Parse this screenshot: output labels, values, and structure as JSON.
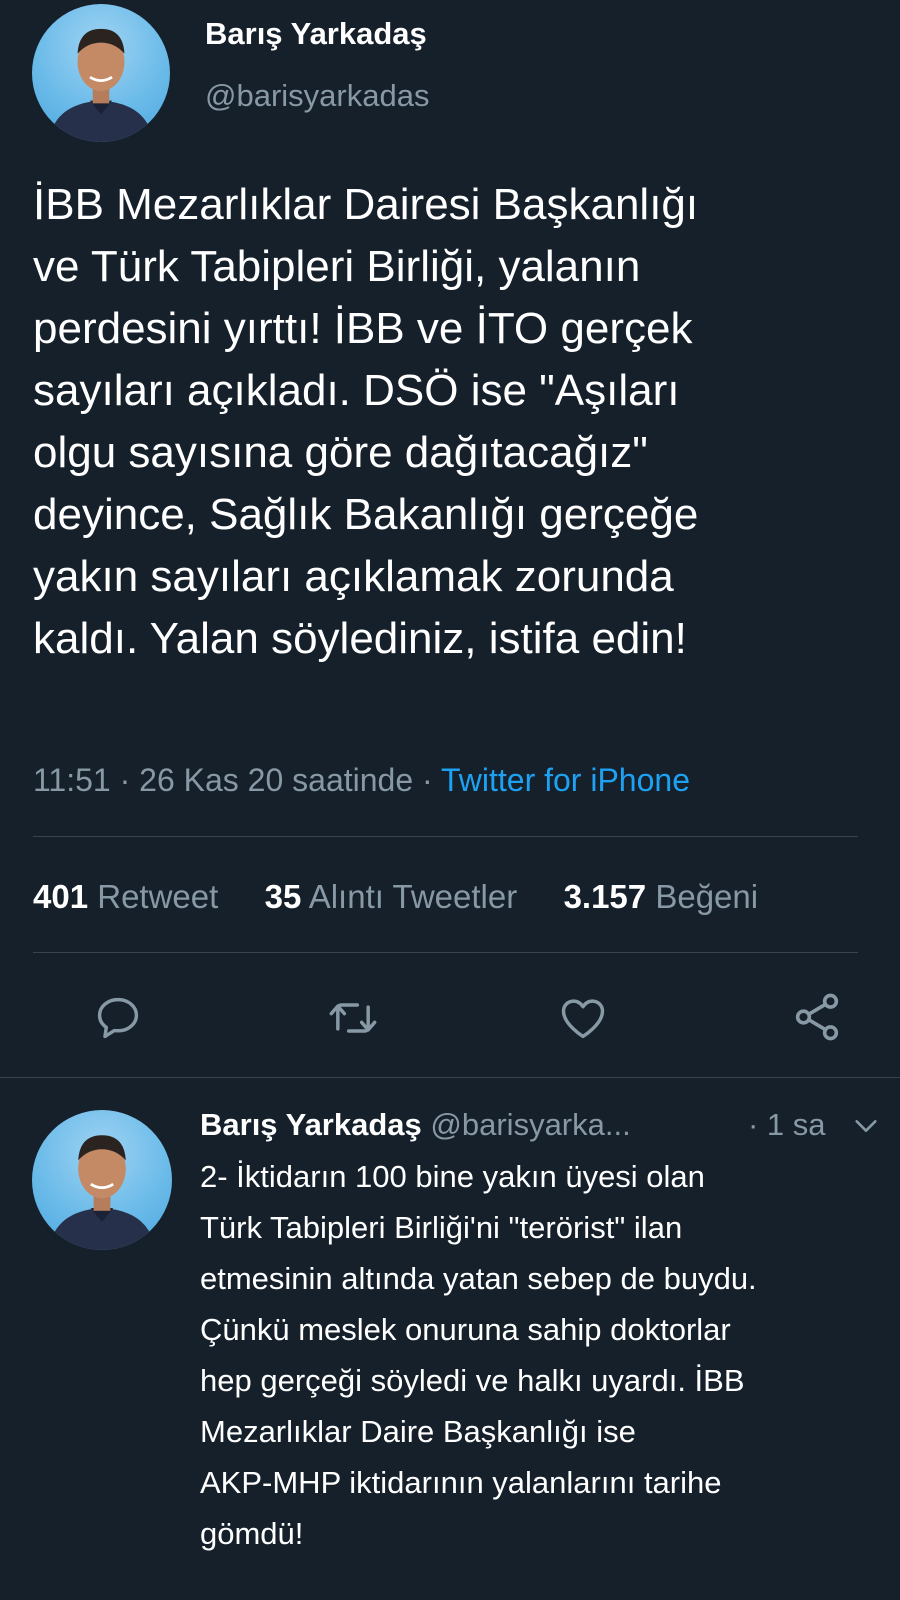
{
  "tweet": {
    "author_name": "Barış Yarkadaş",
    "author_handle": "@barisyarkadas",
    "text": "İBB Mezarlıklar Dairesi Başkanlığı\nve Türk Tabipleri Birliği, yalanın\nperdesini yırttı! İBB ve İTO gerçek\nsayıları açıkladı. DSÖ ise \"Aşıları\nolgu sayısına göre dağıtacağız\"\ndeyince, Sağlık Bakanlığı gerçeğe\nyakın sayıları açıklamak zorunda\nkaldı. Yalan söylediniz, istifa edin!",
    "time": "11:51 · 26 Kas 20 saatinde · ",
    "source": "Twitter for iPhone",
    "stats": {
      "retweets_count": "401",
      "retweets_label": "Retweet",
      "quotes_count": "35",
      "quotes_label": "Alıntı Tweetler",
      "likes_count": "3.157",
      "likes_label": "Beğeni"
    },
    "actions": [
      "reply-icon",
      "retweet-icon",
      "like-icon",
      "share-icon"
    ]
  },
  "reply": {
    "author_name": "Barış Yarkadaş",
    "author_handle": "@barisyarka...",
    "time": "· 1 sa",
    "text": "2- İktidarın 100 bine yakın üyesi olan\nTürk Tabipleri Birliği'ni \"terörist\" ilan\netmesinin altında yatan sebep de buydu.\nÇünkü meslek onuruna sahip doktorlar\nhep gerçeği söyledi ve halkı uyardı. İBB\nMezarlıklar Daire Başkanlığı ise\nAKP-MHP iktidarının yalanlarını tarihe\ngömdü!"
  },
  "colors": {
    "background": "#15202b",
    "text": "#ffffff",
    "muted": "#8899a6",
    "link": "#1da1f2",
    "divider": "#38444d"
  }
}
